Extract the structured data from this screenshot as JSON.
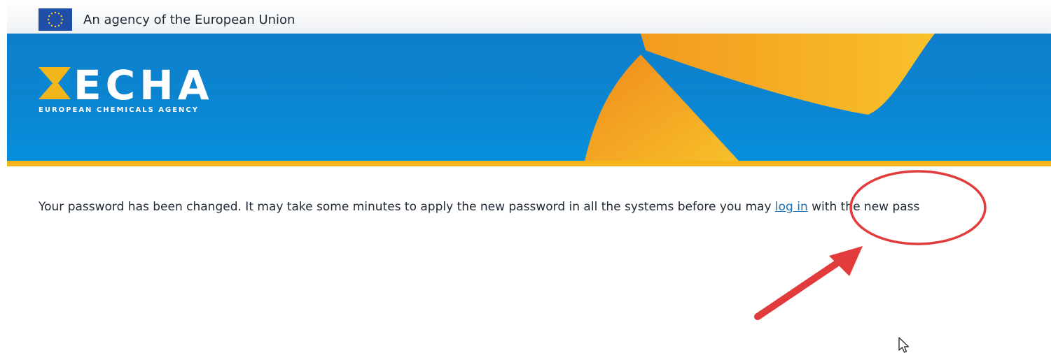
{
  "eu_bar": {
    "flag_icon": "eu-flag-icon",
    "text": "An agency of the European Union"
  },
  "header": {
    "logo_text": "ECHA",
    "logo_subtitle": "EUROPEAN CHEMICALS AGENCY",
    "colors": {
      "banner_blue": "#0a86d2",
      "accent_yellow": "#f2b51c",
      "ray_orange": "#f39a1e"
    }
  },
  "main": {
    "message_before": "Your password has been changed. It may take some minutes to apply the new password in all the systems before you may ",
    "login_link": "log in",
    "message_after": " with the new pass"
  },
  "annotation": {
    "highlight_color": "#e23b3b"
  }
}
